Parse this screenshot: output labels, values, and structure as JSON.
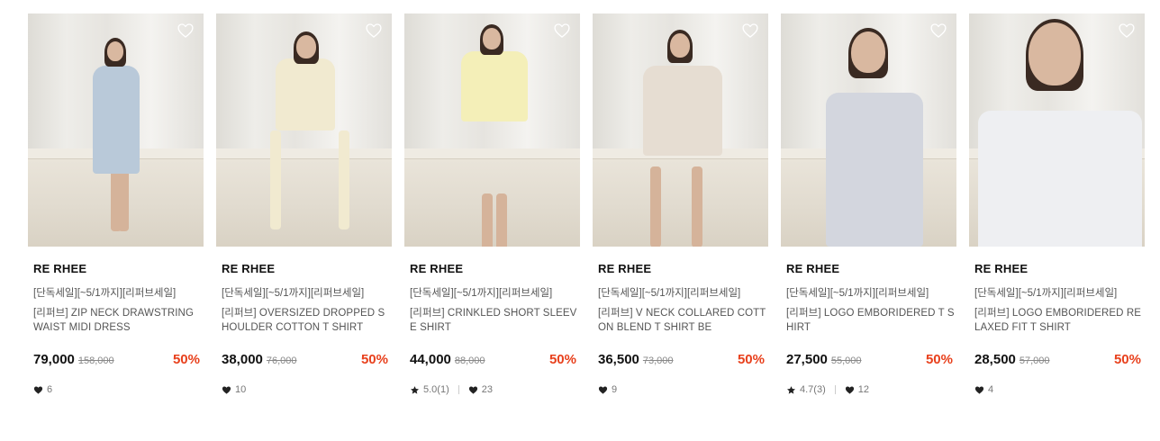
{
  "colors": {
    "discount": "#e8401c",
    "text": "#111111",
    "muted": "#777777"
  },
  "icons": {
    "wishlist": "heart-outline-icon",
    "like": "heart-icon",
    "rating": "star-icon"
  },
  "products": [
    {
      "brand": "RE RHEE",
      "promo": "[단독세일][~5/1까지][리퍼브세일]",
      "name": "[리퍼브] ZIP NECK DRAWSTRING WAIST MIDI DRESS",
      "price": "79,000",
      "original_price": "158,000",
      "discount": "50%",
      "rating": null,
      "likes": "6",
      "outfit_color": "#b9c9d9"
    },
    {
      "brand": "RE RHEE",
      "promo": "[단독세일][~5/1까지][리퍼브세일]",
      "name": "[리퍼브] OVERSIZED DROPPED SHOULDER COTTON T SHIRT",
      "price": "38,000",
      "original_price": "76,000",
      "discount": "50%",
      "rating": null,
      "likes": "10",
      "outfit_color": "#f1ead0"
    },
    {
      "brand": "RE RHEE",
      "promo": "[단독세일][~5/1까지][리퍼브세일]",
      "name": "[리퍼브] CRINKLED SHORT SLEEVE SHIRT",
      "price": "44,000",
      "original_price": "88,000",
      "discount": "50%",
      "rating": "5.0(1)",
      "likes": "23",
      "outfit_color": "#f4efb8"
    },
    {
      "brand": "RE RHEE",
      "promo": "[단독세일][~5/1까지][리퍼브세일]",
      "name": "[리퍼브] V NECK COLLARED COTTON BLEND T SHIRT BE",
      "price": "36,500",
      "original_price": "73,000",
      "discount": "50%",
      "rating": null,
      "likes": "9",
      "outfit_color": "#e6ddd2"
    },
    {
      "brand": "RE RHEE",
      "promo": "[단독세일][~5/1까지][리퍼브세일]",
      "name": "[리퍼브] LOGO EMBORIDERED T SHIRT",
      "price": "27,500",
      "original_price": "55,000",
      "discount": "50%",
      "rating": "4.7(3)",
      "likes": "12",
      "outfit_color": "#d3d6de"
    },
    {
      "brand": "RE RHEE",
      "promo": "[단독세일][~5/1까지][리퍼브세일]",
      "name": "[리퍼브] LOGO EMBORIDERED RELAXED FIT T SHIRT",
      "price": "28,500",
      "original_price": "57,000",
      "discount": "50%",
      "rating": null,
      "likes": "4",
      "outfit_color": "#eeeff2"
    }
  ]
}
